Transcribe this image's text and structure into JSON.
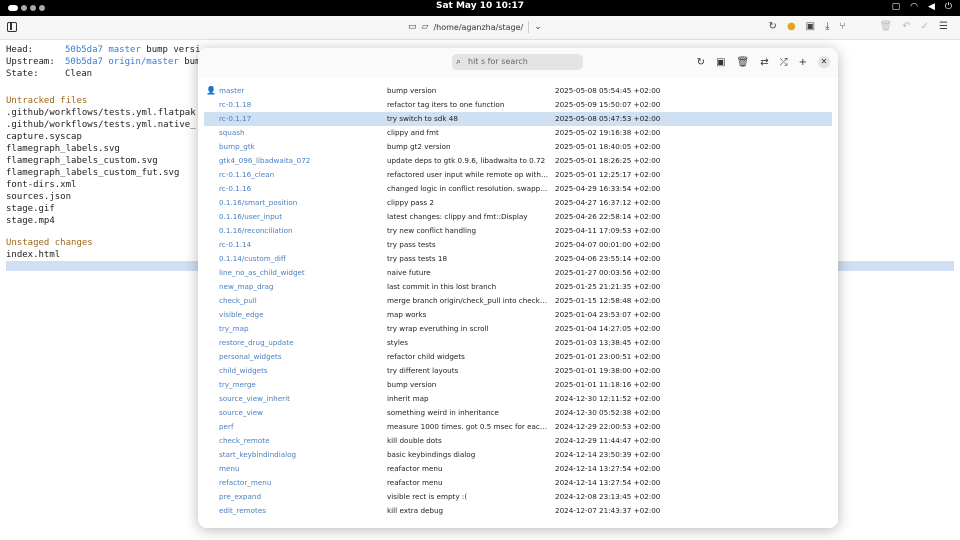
{
  "system_bar": {
    "clock": "Sat May 10  10:17"
  },
  "header": {
    "path": "/home/aganzha/stage/",
    "icons": [
      "sidebar-icon",
      "monitor-icon",
      "folder-icon",
      "chevron-down-icon",
      "refresh-icon",
      "warning-icon",
      "save-icon",
      "download-icon",
      "branch-icon",
      "trash-icon",
      "undo-icon",
      "check-icon",
      "menu-icon"
    ]
  },
  "status": {
    "head_label": "Head:",
    "head_hash": "50b5da7",
    "head_branch": "master",
    "head_msg": "bump versi",
    "upstream_label": "Upstream:",
    "upstream_hash": "50b5da7",
    "upstream_branch": "origin/master",
    "upstream_msg": "bum",
    "state_label": "State:",
    "state_value": "Clean"
  },
  "untracked": {
    "title": "Untracked files",
    "files": [
      ".github/workflows/tests.yml.flatpak",
      ".github/workflows/tests.yml.native_",
      "capture.syscap",
      "flamegraph_labels.svg",
      "flamegraph_labels_custom.svg",
      "flamegraph_labels_custom_fut.svg",
      "font-dirs.xml",
      "sources.json",
      "stage.gif",
      "stage.mp4"
    ]
  },
  "unstaged": {
    "title": "Unstaged changes",
    "files": [
      "index.html"
    ]
  },
  "dialog": {
    "search_placeholder": "hit s for search",
    "branches": [
      {
        "name": "master",
        "message": "bump version",
        "date": "2025-05-08 05:54:45 +02:00",
        "current": true
      },
      {
        "name": "rc-0.1.18",
        "message": "refactor tag iters to one function",
        "date": "2025-05-09 15:50:07 +02:00"
      },
      {
        "name": "rc-0.1.17",
        "message": "try switch to sdk 48",
        "date": "2025-05-08 05:47:53 +02:00",
        "selected": true
      },
      {
        "name": "squash",
        "message": "clippy and fmt",
        "date": "2025-05-02 19:16:38 +02:00"
      },
      {
        "name": "bump_gtk",
        "message": "bump gt2 version",
        "date": "2025-05-01 18:40:05 +02:00"
      },
      {
        "name": "gtk4_096_libadwaita_072",
        "message": "update deps to gtk 0.9.6, libadwaita to 0.72",
        "date": "2025-05-01 18:26:25 +02:00"
      },
      {
        "name": "rc-0.1.16_clean",
        "message": "refactored user input while remote op with c...",
        "date": "2025-05-01 12:25:17 +02:00"
      },
      {
        "name": "rc-0.1.16",
        "message": "changed logic in conflict resolution. swappe...",
        "date": "2025-04-29 16:33:54 +02:00"
      },
      {
        "name": "0.1.16/smart_position",
        "message": "clippy pass 2",
        "date": "2025-04-27 16:37:12 +02:00"
      },
      {
        "name": "0.1.16/user_input",
        "message": "latest changes: clippy and fmt::Display",
        "date": "2025-04-26 22:58:14 +02:00"
      },
      {
        "name": "0.1.16/reconciliation",
        "message": "try new conflict handling",
        "date": "2025-04-11 17:09:53 +02:00"
      },
      {
        "name": "rc-0.1.14",
        "message": "try pass tests",
        "date": "2025-04-07 00:01:00 +02:00"
      },
      {
        "name": "0.1.14/custom_diff",
        "message": "try pass tests 18",
        "date": "2025-04-06 23:55:14 +02:00"
      },
      {
        "name": "line_no_as_child_widget",
        "message": "naive future",
        "date": "2025-01-27 00:03:56 +02:00"
      },
      {
        "name": "new_map_drag",
        "message": "last commit in this lost branch",
        "date": "2025-01-25 21:21:35 +02:00"
      },
      {
        "name": "check_pull",
        "message": "merge branch origin/check_pull into check_...",
        "date": "2025-01-15 12:58:48 +02:00"
      },
      {
        "name": "visible_edge",
        "message": "map works",
        "date": "2025-01-04 23:53:07 +02:00"
      },
      {
        "name": "try_map",
        "message": "try wrap everuthing in scroll",
        "date": "2025-01-04 14:27:05 +02:00"
      },
      {
        "name": "restore_drug_update",
        "message": "styles",
        "date": "2025-01-03 13:38:45 +02:00"
      },
      {
        "name": "personal_widgets",
        "message": "refactor child widgets",
        "date": "2025-01-01 23:00:51 +02:00"
      },
      {
        "name": "child_widgets",
        "message": "try different layouts",
        "date": "2025-01-01 19:38:00 +02:00"
      },
      {
        "name": "try_merge",
        "message": "bump version",
        "date": "2025-01-01 11:18:16 +02:00"
      },
      {
        "name": "source_view_inherit",
        "message": "inherit map",
        "date": "2024-12-30 12:11:52 +02:00"
      },
      {
        "name": "source_view",
        "message": "something weird in inheritance",
        "date": "2024-12-30 05:52:38 +02:00"
      },
      {
        "name": "perf",
        "message": "measure 1000 times. got 0.5 msec for each r...",
        "date": "2024-12-29 22:00:53 +02:00"
      },
      {
        "name": "check_remote",
        "message": "kill double dots",
        "date": "2024-12-29 11:44:47 +02:00"
      },
      {
        "name": "start_keybindindialog",
        "message": "basic keybindings dialog",
        "date": "2024-12-14 23:50:39 +02:00"
      },
      {
        "name": "menu",
        "message": "reafactor menu",
        "date": "2024-12-14 13:27:54 +02:00"
      },
      {
        "name": "refactor_menu",
        "message": "reafactor menu",
        "date": "2024-12-14 13:27:54 +02:00"
      },
      {
        "name": "pre_expand",
        "message": "visible rect is empty :(",
        "date": "2024-12-08 23:13:45 +02:00"
      },
      {
        "name": "edit_remotes",
        "message": "kill extra debug",
        "date": "2024-12-07 21:43:37 +02:00"
      }
    ]
  },
  "colors": {
    "accent": "#3a7bd5",
    "selection": "#cfe0f3",
    "section_header": "#a0661a"
  }
}
